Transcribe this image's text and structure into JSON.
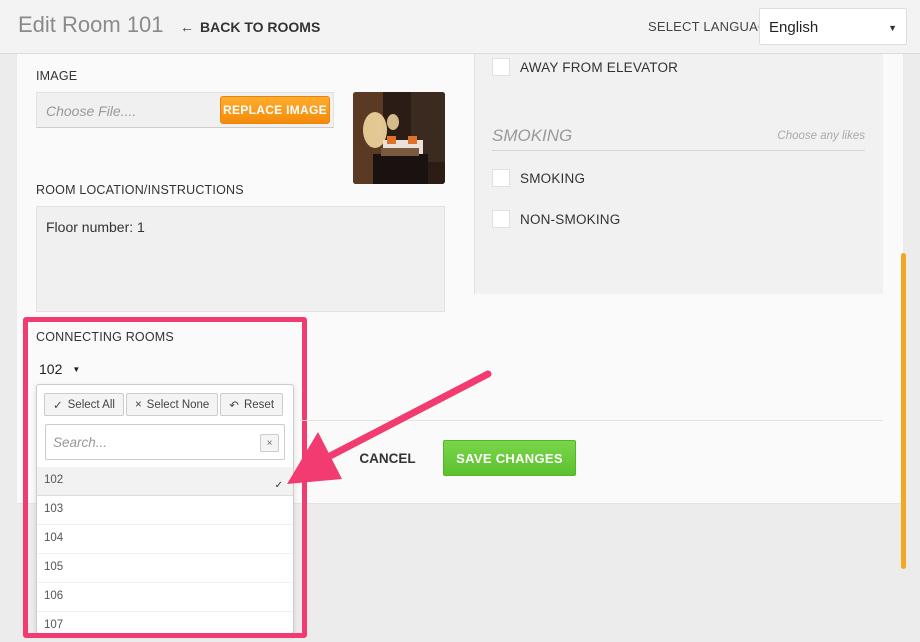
{
  "header": {
    "title": "Edit Room 101",
    "back_label": "BACK TO ROOMS",
    "language_label": "SELECT LANGUAGE",
    "language_value": "English"
  },
  "image_section": {
    "label": "IMAGE",
    "file_placeholder": "Choose File....",
    "replace_button": "REPLACE IMAGE"
  },
  "location_section": {
    "label": "ROOM LOCATION/INSTRUCTIONS",
    "value": "Floor number: 1"
  },
  "preferences": {
    "away_from_elevator": "AWAY FROM ELEVATOR",
    "smoking_heading": "SMOKING",
    "smoking_hint": "Choose any likes",
    "smoking": "SMOKING",
    "non_smoking": "NON-SMOKING"
  },
  "connecting_rooms": {
    "label": "CONNECTING ROOMS",
    "selected_display": "102",
    "select_all": "Select All",
    "select_none": "Select None",
    "reset": "Reset",
    "search_placeholder": "Search...",
    "options": [
      "102",
      "103",
      "104",
      "105",
      "106",
      "107"
    ],
    "selected_option": "102"
  },
  "actions": {
    "cancel": "CANCEL",
    "save": "SAVE CHANGES"
  },
  "colors": {
    "highlight": "#f23b70",
    "orange_button": "#f48b0b",
    "green_button": "#5cc12e",
    "scrollbar": "#f4a722"
  },
  "icons": {
    "back": "arrow-left-icon",
    "caret": "caret-down-icon",
    "check": "check-icon",
    "close": "close-icon",
    "undo": "undo-icon"
  }
}
